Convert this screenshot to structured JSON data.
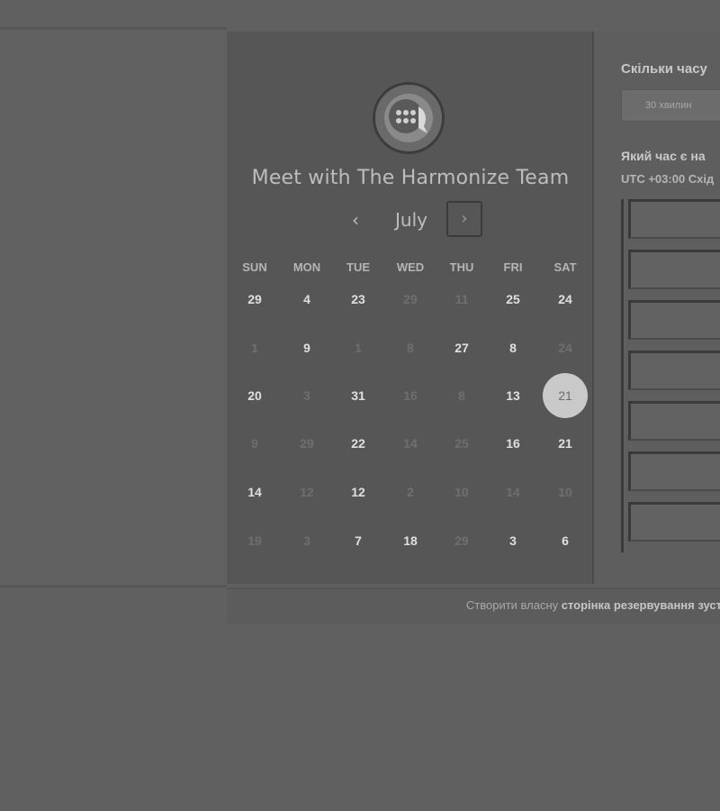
{
  "calendar": {
    "title": "Meet with The Harmonize Team",
    "month": "July",
    "prev_label": "‹",
    "next_label": "›",
    "weekdays": [
      "SUN",
      "MON",
      "TUE",
      "WED",
      "THU",
      "FRI",
      "SAT"
    ],
    "weeks": [
      [
        {
          "d": "29",
          "on": true
        },
        {
          "d": "4",
          "on": true
        },
        {
          "d": "23",
          "on": true
        },
        {
          "d": "29",
          "on": false
        },
        {
          "d": "11",
          "on": false
        },
        {
          "d": "25",
          "on": true
        },
        {
          "d": "24",
          "on": true
        }
      ],
      [
        {
          "d": "1",
          "on": false
        },
        {
          "d": "9",
          "on": true
        },
        {
          "d": "1",
          "on": false
        },
        {
          "d": "8",
          "on": false
        },
        {
          "d": "27",
          "on": true
        },
        {
          "d": "8",
          "on": true
        },
        {
          "d": "24",
          "on": false
        }
      ],
      [
        {
          "d": "20",
          "on": true
        },
        {
          "d": "3",
          "on": false
        },
        {
          "d": "31",
          "on": true
        },
        {
          "d": "16",
          "on": false
        },
        {
          "d": "8",
          "on": false
        },
        {
          "d": "13",
          "on": true
        },
        {
          "d": "21",
          "on": true,
          "selected": true
        }
      ],
      [
        {
          "d": "9",
          "on": false
        },
        {
          "d": "29",
          "on": false
        },
        {
          "d": "22",
          "on": true
        },
        {
          "d": "14",
          "on": false
        },
        {
          "d": "25",
          "on": false
        },
        {
          "d": "16",
          "on": true
        },
        {
          "d": "21",
          "on": true
        }
      ],
      [
        {
          "d": "14",
          "on": true
        },
        {
          "d": "12",
          "on": false
        },
        {
          "d": "12",
          "on": true
        },
        {
          "d": "2",
          "on": false
        },
        {
          "d": "10",
          "on": false
        },
        {
          "d": "14",
          "on": false
        },
        {
          "d": "10",
          "on": false
        }
      ],
      [
        {
          "d": "19",
          "on": false
        },
        {
          "d": "3",
          "on": false
        },
        {
          "d": "7",
          "on": true
        },
        {
          "d": "18",
          "on": true
        },
        {
          "d": "29",
          "on": false
        },
        {
          "d": "3",
          "on": true
        },
        {
          "d": "6",
          "on": true
        }
      ]
    ]
  },
  "booking": {
    "duration_question": "Скільки часу",
    "duration_option": "30 хвилин",
    "time_question": "Який час є на",
    "timezone": "UTC +03:00 Схід",
    "slot_count": 7
  },
  "footer": {
    "prefix": "Створити власну ",
    "link": "сторінка резервування зуст"
  },
  "colors": {
    "background": "#606060",
    "card": "#565656",
    "selected_day": "#c9c9c9"
  },
  "icons": {
    "avatar": "chat-bubble-logo-icon",
    "prev": "chevron-left-icon",
    "next": "chevron-right-icon"
  }
}
